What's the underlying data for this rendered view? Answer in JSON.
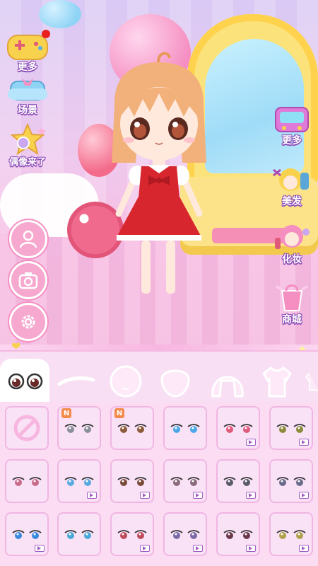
{
  "left_menu": {
    "more_label": "更多",
    "scene_label": "场景",
    "idol_label": "偶像来了"
  },
  "right_menu": {
    "more_label": "更多",
    "hair_label": "美发",
    "makeup_label": "化妆",
    "shop_label": "商城"
  },
  "tabs": [
    "eyes-tab",
    "eyebrows-tab",
    "mouth-tab",
    "face-tab",
    "hair-tab",
    "clothes-tab",
    "accessory-tab"
  ],
  "badges": {
    "new": "N"
  },
  "grid": {
    "rows": [
      [
        {
          "type": "none"
        },
        {
          "iris": "#8a8f99",
          "badge": "new",
          "video": false
        },
        {
          "iris": "#8a5a3a",
          "badge": "new",
          "video": false
        },
        {
          "iris": "#4aa8e8",
          "badge": "",
          "video": false
        },
        {
          "iris": "#e05a7a",
          "badge": "",
          "video": true
        },
        {
          "iris": "#8a8a3a",
          "badge": "",
          "video": true
        }
      ],
      [
        {
          "iris": "#c86a8a",
          "badge": "",
          "video": false
        },
        {
          "iris": "#5aa8e0",
          "badge": "",
          "video": true
        },
        {
          "iris": "#7a4a3a",
          "badge": "",
          "video": true
        },
        {
          "iris": "#8a6a7a",
          "badge": "",
          "video": true
        },
        {
          "iris": "#5a5a6a",
          "badge": "",
          "video": true
        },
        {
          "iris": "#6a6a8a",
          "badge": "",
          "video": true
        }
      ],
      [
        {
          "iris": "#3a8ae0",
          "badge": "",
          "video": true
        },
        {
          "iris": "#4aa8d8",
          "badge": "",
          "video": false
        },
        {
          "iris": "#c04a5a",
          "badge": "",
          "video": true
        },
        {
          "iris": "#7a6aa8",
          "badge": "",
          "video": true
        },
        {
          "iris": "#6a3a4a",
          "badge": "",
          "video": true
        },
        {
          "iris": "#b0a04a",
          "badge": "",
          "video": true
        }
      ]
    ]
  },
  "colors": {
    "accent": "#f58fc2",
    "label_outline": "#8a4ab6",
    "cell_border": "#f0b6e3"
  }
}
